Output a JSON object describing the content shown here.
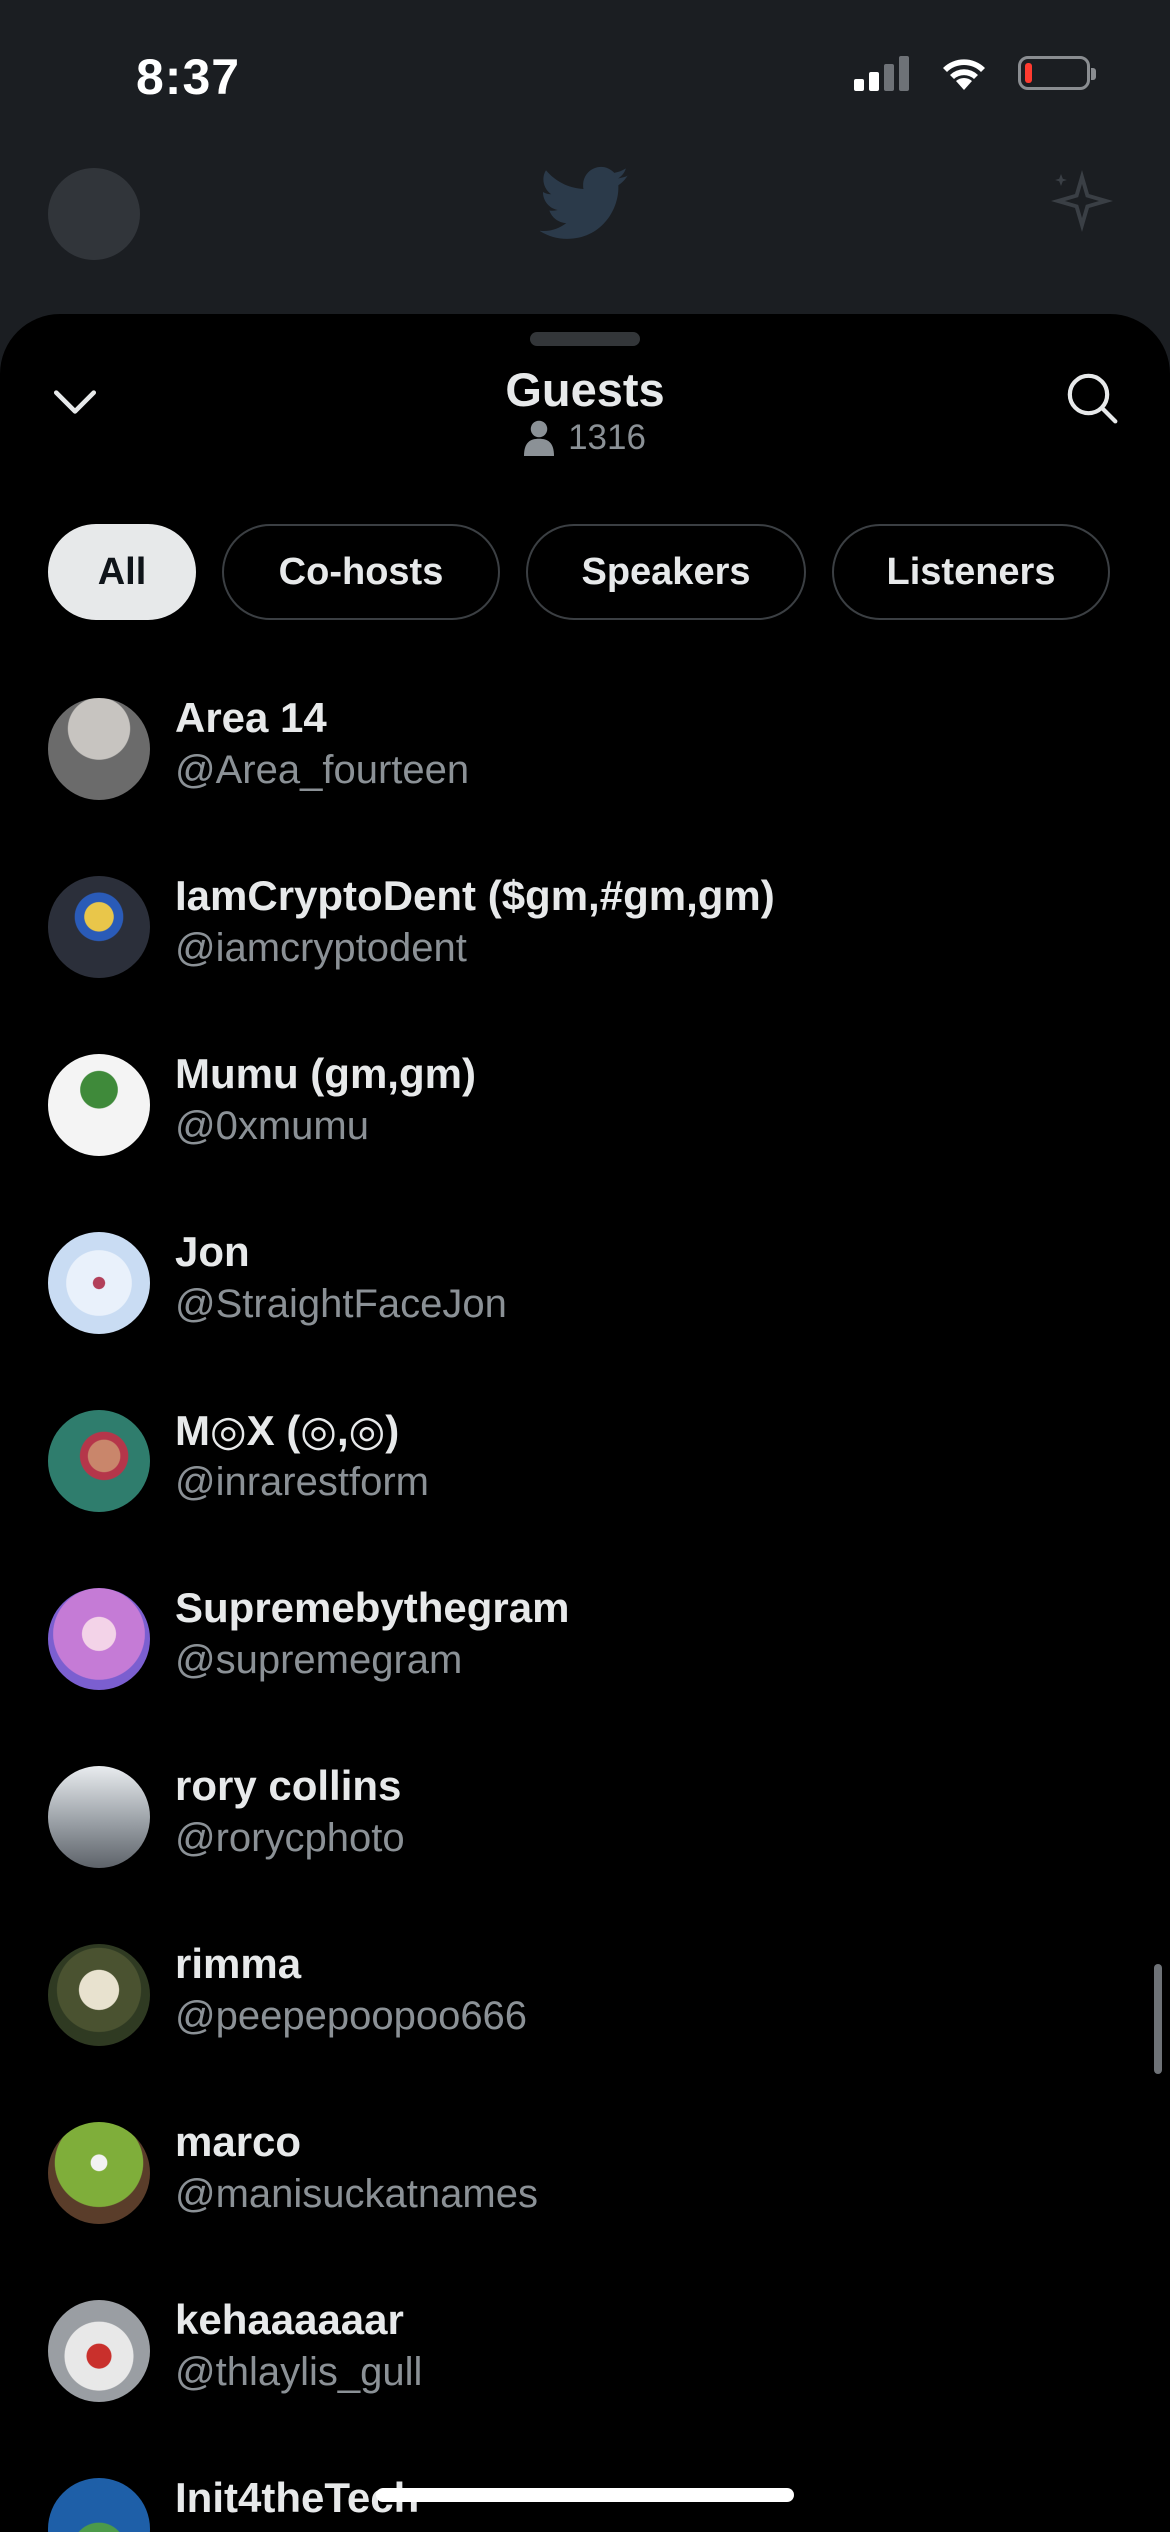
{
  "status_bar": {
    "time": "8:37"
  },
  "header": {
    "title": "Guests",
    "count": "1316"
  },
  "tabs": [
    {
      "label": "All",
      "active": true
    },
    {
      "label": "Co-hosts",
      "active": false
    },
    {
      "label": "Speakers",
      "active": false
    },
    {
      "label": "Listeners",
      "active": false
    }
  ],
  "guests": [
    {
      "name": "Area 14",
      "handle": "@Area_fourteen",
      "avatar_color": "#6b6b6b"
    },
    {
      "name": "IamCryptoDent ($gm,#gm,gm)",
      "handle": "@iamcryptodent",
      "avatar_color": "#2b2f3a"
    },
    {
      "name": "Mumu (gm,gm)",
      "handle": "@0xmumu",
      "avatar_color": "#f4f4f4"
    },
    {
      "name": "Jon",
      "handle": "@StraightFaceJon",
      "avatar_color": "#c9dcf3"
    },
    {
      "name": "M◎X (◎,◎)",
      "handle": "@inrarestform",
      "avatar_color": "#2f7d6d"
    },
    {
      "name": "Supremebythegram",
      "handle": "@supremegram",
      "avatar_color": "#c57bd6"
    },
    {
      "name": "rory collins",
      "handle": "@rorycphoto",
      "avatar_color": "#b8bcc2"
    },
    {
      "name": "rimma",
      "handle": "@peepepoopoo666",
      "avatar_color": "#2f3a22"
    },
    {
      "name": "marco",
      "handle": "@manisuckatnames",
      "avatar_color": "#7fae3a"
    },
    {
      "name": "kehaaaaaar",
      "handle": "@thlaylis_gull",
      "avatar_color": "#9a9ea3"
    },
    {
      "name": "Init4theTech",
      "handle": "",
      "avatar_color": "#1e5fa8"
    }
  ]
}
